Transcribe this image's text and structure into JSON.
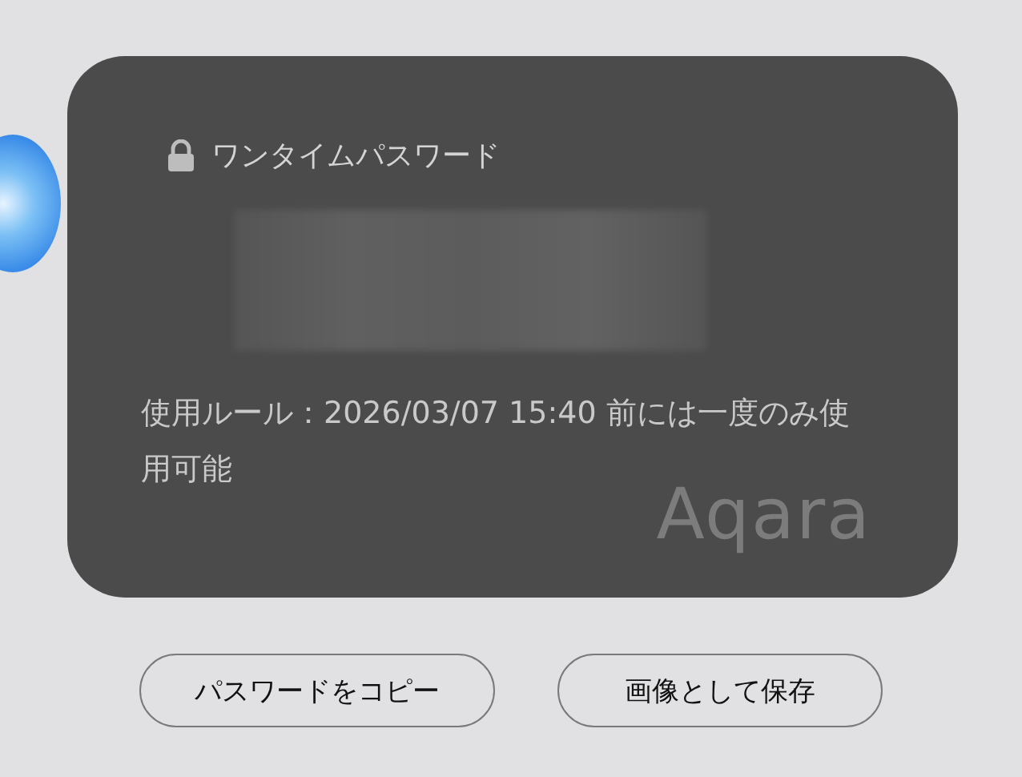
{
  "card": {
    "title": "ワンタイムパスワード",
    "rule": "使用ルール：2026/03/07 15:40 前には一度のみ使用可能",
    "logo": "Aqara"
  },
  "buttons": [
    {
      "label": "パスワードをコピー"
    },
    {
      "label": "画像として保存"
    }
  ]
}
